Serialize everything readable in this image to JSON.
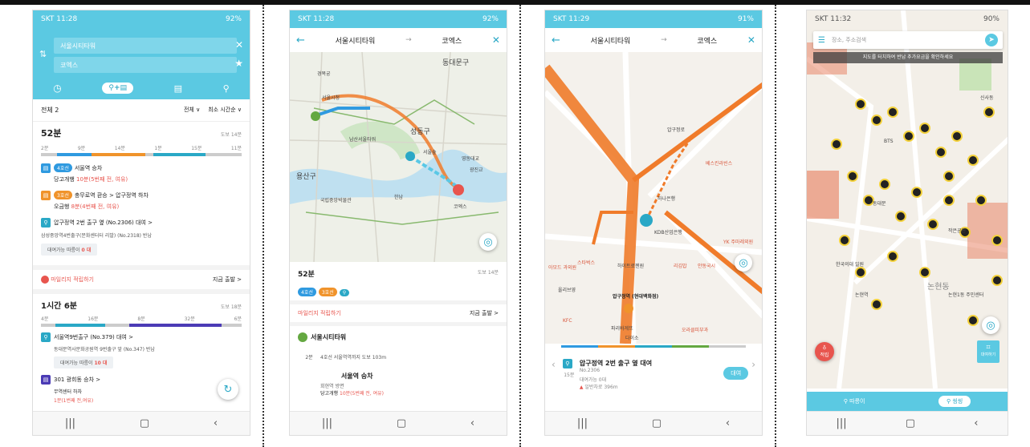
{
  "screen1": {
    "status": {
      "time": "SKT 11:28",
      "right": "92%"
    },
    "origin": "서울시티타워",
    "destination": "코엑스",
    "tabs": [
      "전체",
      "대중교통+따릉이",
      "대중교통",
      "따릉이"
    ],
    "summary": {
      "count": "전체 2",
      "filter": "전체 ∨",
      "sort": "최소 시간순 ∨"
    },
    "route1": {
      "time": "52분",
      "walk": "도보 14분",
      "segments": [
        "2분",
        "9분",
        "14분",
        "1분",
        "15분",
        "11분"
      ],
      "steps": [
        {
          "badge": "4호선",
          "text": "서울역 승차",
          "sub": "당고개행",
          "hint": "10분(5번째 전, 여유)"
        },
        {
          "badge": "3호선",
          "text": "충무로역 환승 > 압구정역 하차",
          "sub": "오금행",
          "hint": "8분(4번째 전, 여유)"
        },
        {
          "text": "압구정역 2번 출구 옆 (No.2306) 대여 >",
          "sub": "삼성중앙역4번출구(문화센터터 리발) (No.2318) 반납"
        }
      ],
      "bikes_label": "대여가능 따릉이",
      "bikes": "0 대"
    },
    "mileage": "마일리지 적립하기",
    "depart": "지금 출발 >",
    "route2": {
      "time": "1시간 6분",
      "walk": "도보 18분",
      "segments": [
        "4분",
        "16분",
        "8분",
        "32분",
        "6분"
      ],
      "steps": [
        {
          "text": "서울역9번출구 (No.379) 대여 >",
          "sub": "동대문역사문화공원역 9번출구 앞 (No.347) 반납"
        },
        {
          "text": "301 광희동 승차 >",
          "sub": "무역센터 하차",
          "hint": "1분(1번째 전,여유)"
        }
      ],
      "bikes_label": "대여가능 따릉이",
      "bikes": "10 대"
    }
  },
  "screen2": {
    "status": {
      "time": "SKT 11:28",
      "right": "92%"
    },
    "from": "서울시티타워",
    "arrow": "→",
    "to": "코엑스",
    "map_labels": [
      "동대문구",
      "경복궁",
      "서울시청",
      "남산서울타워",
      "성동구",
      "용산구",
      "국립중앙박물관",
      "서울숲",
      "한남",
      "광진교",
      "코엑스",
      "영동대교"
    ],
    "summary": {
      "time": "52분",
      "walk": "도보 14분",
      "badges": [
        "4호선",
        "3호선"
      ]
    },
    "mileage": "마일리지 적립하기",
    "depart": "지금 출발 >",
    "start": {
      "label": "서울시티타워",
      "tag": "출발"
    },
    "walk": {
      "mins": "2분",
      "text": "4호선 서울역역까지 도보 103m"
    },
    "board": {
      "badge": "4호선",
      "text": "서울역 승차",
      "sub1": "회현역 방면",
      "sub2": "당고개행",
      "hint": "10분(5번째 전, 여유)"
    }
  },
  "screen3": {
    "status": {
      "time": "SKT 11:29",
      "right": "91%"
    },
    "from": "서울시티타워",
    "arrow": "→",
    "to": "코엑스",
    "map_labels": [
      "압구정로",
      "베스킨라빈스",
      "하나은행",
      "KDB산업은행",
      "YK 주마레외원",
      "스타벅스",
      "리김밥",
      "안동국시",
      "압구정역 (현대백화점)",
      "올리브영",
      "KFC",
      "파리바게뜨",
      "오라클피부과",
      "다이소",
      "아모드 과외원",
      "하이트로젠원"
    ],
    "card": {
      "title": "압구정역 2번 출구 옆 대여",
      "no": "No.2306",
      "mins": "15분",
      "avail": "대여가능 0대",
      "road": "일반차로 396m",
      "button": "대여"
    }
  },
  "screen4": {
    "status": {
      "time": "SKT 11:32",
      "right": "90%"
    },
    "search_placeholder": "장소, 주소검색",
    "notice": "지도를 터치하여 반납 추가요금을 확인하세요",
    "map_labels": [
      "BTS",
      "동대문",
      "논현동",
      "논현역",
      "논현1동 주민센터",
      "신사동",
      "한국의대 일원",
      "작은공원"
    ],
    "mileage_btn": "적립",
    "scan_btn": "대여하기",
    "tabs": [
      "따릉이",
      "씽씽"
    ]
  },
  "colors": {
    "primary": "#5bc9e2",
    "line4": "#2f9ae0",
    "line3": "#f0932b",
    "bike": "#2aa8c6",
    "route": "#f07b2a",
    "mileage": "#e8554e"
  }
}
